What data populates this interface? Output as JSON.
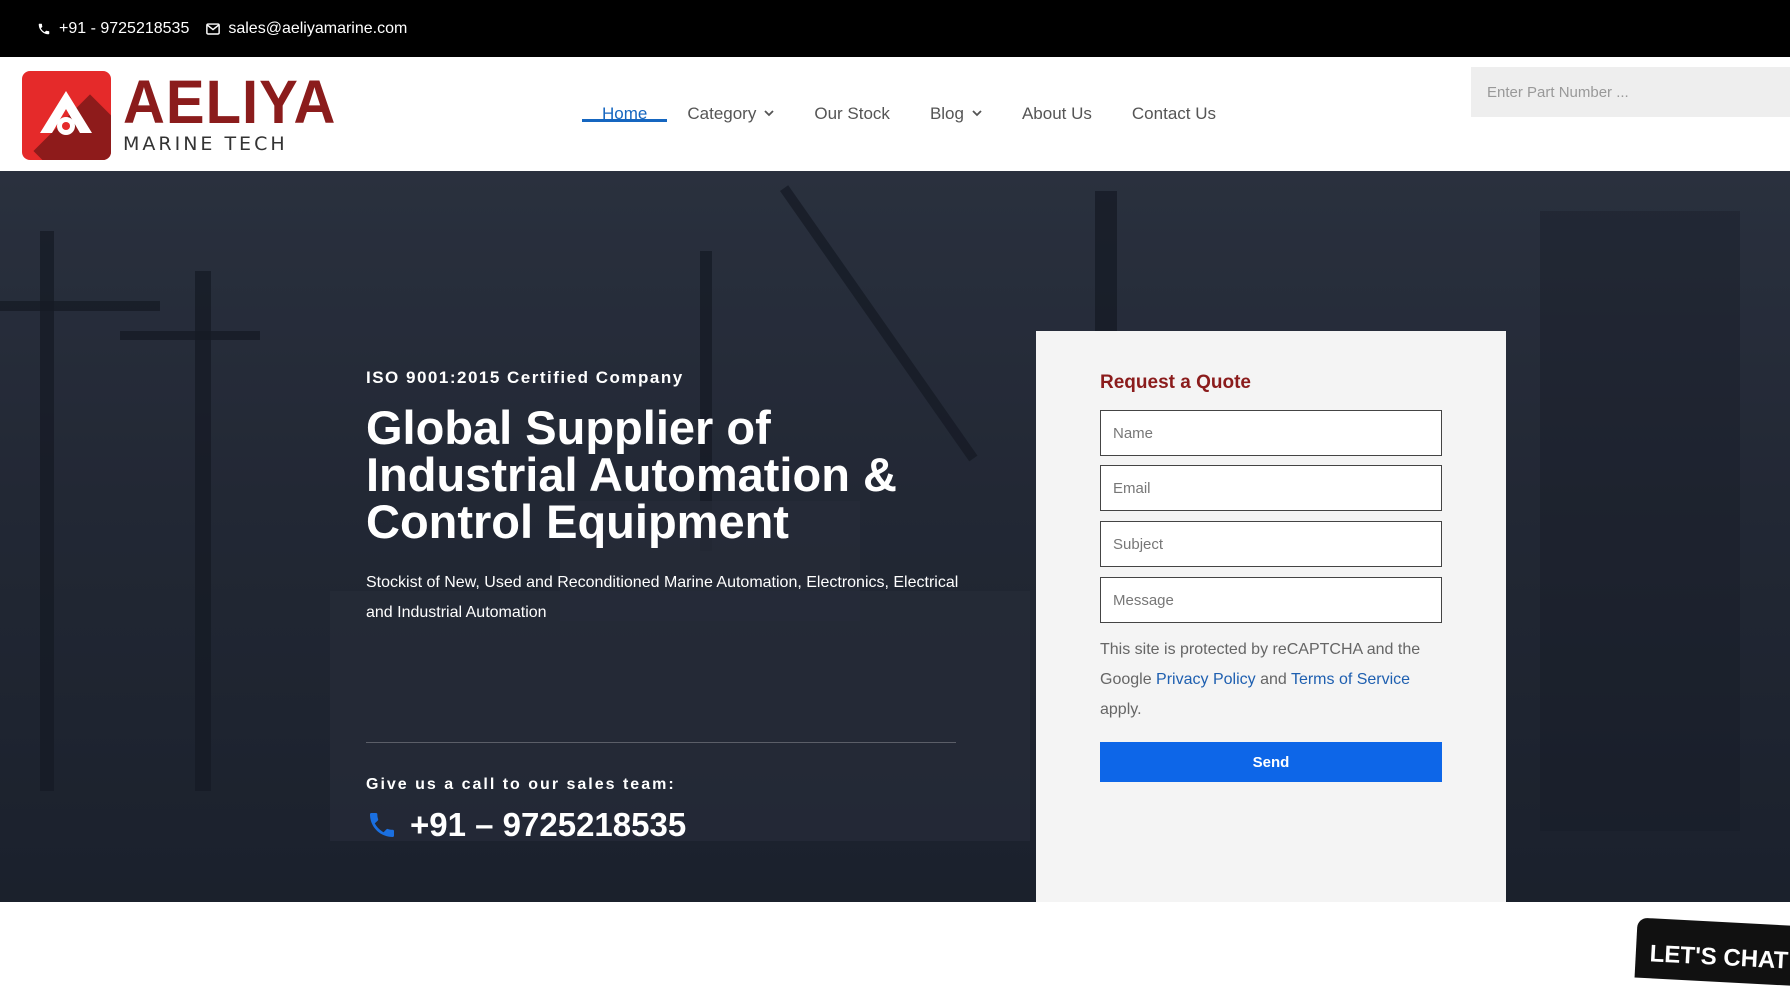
{
  "topbar": {
    "phone": "+91 - 9725218535",
    "email": "sales@aeliyamarine.com"
  },
  "logo": {
    "name": "AELIYA",
    "tagline": "MARINE TECH"
  },
  "nav": {
    "items": [
      {
        "label": "Home",
        "active": true,
        "has_dropdown": false
      },
      {
        "label": "Category",
        "active": false,
        "has_dropdown": true
      },
      {
        "label": "Our Stock",
        "active": false,
        "has_dropdown": false
      },
      {
        "label": "Blog",
        "active": false,
        "has_dropdown": true
      },
      {
        "label": "About Us",
        "active": false,
        "has_dropdown": false
      },
      {
        "label": "Contact Us",
        "active": false,
        "has_dropdown": false
      }
    ]
  },
  "search": {
    "placeholder": "Enter Part Number ..."
  },
  "hero": {
    "certification": "ISO 9001:2015 Certified Company",
    "headline": "Global Supplier of Industrial Automation & Control Equipment",
    "subline": "Stockist of New, Used and Reconditioned Marine Automation, Electronics, Electrical and Industrial Automation",
    "call_label": "Give us a call to our sales team:",
    "phone": "+91 – 9725218535"
  },
  "quote_form": {
    "title": "Request a Quote",
    "fields": {
      "name": "Name",
      "email": "Email",
      "subject": "Subject",
      "message": "Message"
    },
    "notice_prefix": "This site is protected by reCAPTCHA and the Google",
    "privacy_link": "Privacy Policy",
    "notice_and": "and",
    "terms_link": "Terms of Service",
    "notice_suffix": "apply.",
    "send_label": "Send"
  },
  "chat_badge": {
    "label": "LET'S CHAT!"
  },
  "colors": {
    "brand_red": "#8b1c1c",
    "logo_red": "#e52a2a",
    "nav_active": "#1566c0",
    "send_button": "#0d66e8",
    "link": "#1e5fb0"
  }
}
